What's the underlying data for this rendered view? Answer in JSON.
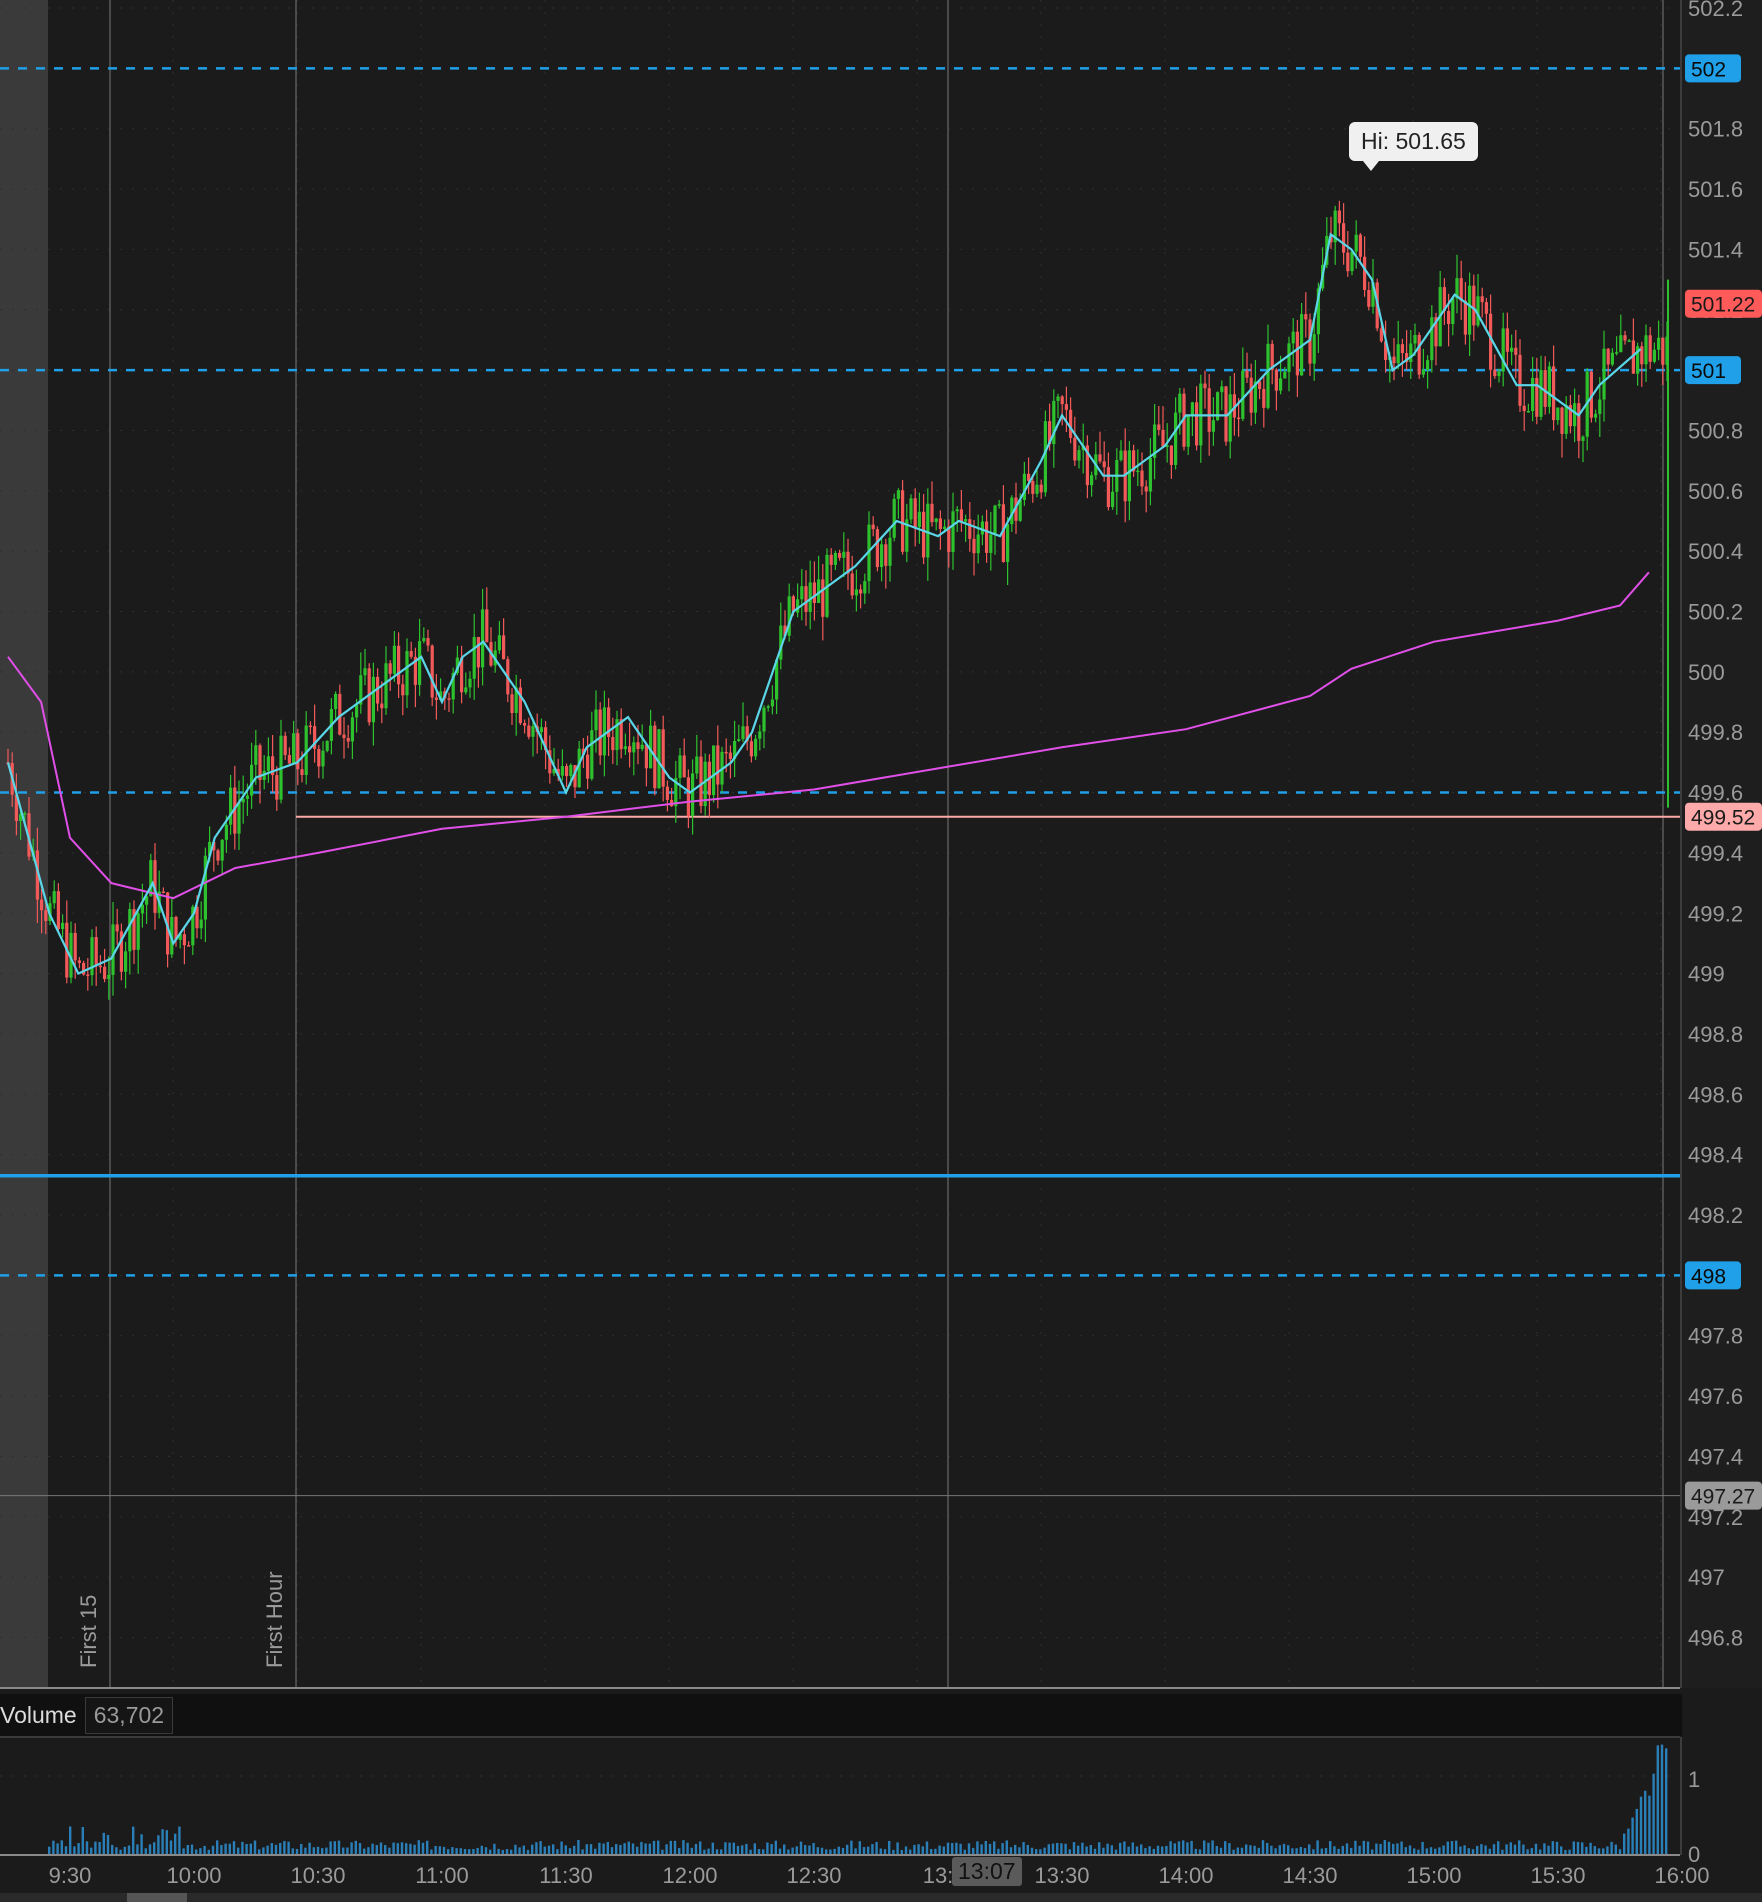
{
  "chart_data": {
    "type": "candlestick",
    "price_axis": {
      "ticks": [
        "502.2",
        "501.8",
        "501.6",
        "501.4",
        "501.2",
        "500.8",
        "500.6",
        "500.4",
        "500.2",
        "500",
        "499.8",
        "499.6",
        "499.4",
        "499.2",
        "499",
        "498.8",
        "498.6",
        "498.4",
        "498.2",
        "497.8",
        "497.6",
        "497.4",
        "497.2",
        "497",
        "496.8"
      ],
      "range": [
        496.64,
        502.24
      ]
    },
    "time_axis": {
      "ticks": [
        "9:30",
        "10:00",
        "10:30",
        "11:00",
        "11:30",
        "12:00",
        "12:30",
        "13:",
        "13:30",
        "14:00",
        "14:30",
        "15:00",
        "15:30",
        "16:00"
      ],
      "range": [
        "9:30",
        "16:00"
      ]
    },
    "price_level_tags": [
      {
        "label": "502",
        "value": 502.0,
        "color": "#1fa0e8",
        "style": "dashed"
      },
      {
        "label": "501",
        "value": 501.0,
        "color": "#1fa0e8",
        "style": "dashed"
      },
      {
        "label": "498",
        "value": 498.0,
        "color": "#1fa0e8",
        "style": "dashed"
      }
    ],
    "unlabeled_levels": [
      {
        "value": 499.6,
        "color": "#1fa0e8",
        "style": "dashed"
      },
      {
        "value": 498.33,
        "color": "#1fa0e8",
        "style": "solid"
      },
      {
        "value": 497.27,
        "color": "#777777",
        "style": "solid"
      }
    ],
    "last_price": {
      "label": "501.22",
      "value": 501.22,
      "color": "#ff5a5a"
    },
    "prev_close": {
      "label": "499.52",
      "value": 499.52,
      "color": "#ffaaaa"
    },
    "gray_level_tag": {
      "label": "497.27",
      "value": 497.27
    },
    "high_label": "Hi: 501.65",
    "high_value": 501.65,
    "session_markers": [
      {
        "label": "First 15",
        "time": "9:45"
      },
      {
        "label": "First Hour",
        "time": "10:30"
      }
    ],
    "cursor_time": "13:07",
    "ema_path": [
      [
        "9:15",
        499.7
      ],
      [
        "9:25",
        499.2
      ],
      [
        "9:32",
        499.0
      ],
      [
        "9:40",
        499.05
      ],
      [
        "9:50",
        499.3
      ],
      [
        "9:55",
        499.1
      ],
      [
        "10:00",
        499.2
      ],
      [
        "10:05",
        499.45
      ],
      [
        "10:15",
        499.65
      ],
      [
        "10:25",
        499.7
      ],
      [
        "10:35",
        499.85
      ],
      [
        "10:45",
        499.95
      ],
      [
        "10:55",
        500.05
      ],
      [
        "11:00",
        499.9
      ],
      [
        "11:05",
        500.05
      ],
      [
        "11:10",
        500.1
      ],
      [
        "11:20",
        499.9
      ],
      [
        "11:30",
        499.6
      ],
      [
        "11:35",
        499.75
      ],
      [
        "11:45",
        499.85
      ],
      [
        "11:55",
        499.65
      ],
      [
        "12:00",
        499.6
      ],
      [
        "12:10",
        499.7
      ],
      [
        "12:15",
        499.8
      ],
      [
        "12:25",
        500.2
      ],
      [
        "12:30",
        500.25
      ],
      [
        "12:40",
        500.35
      ],
      [
        "12:50",
        500.5
      ],
      [
        "13:00",
        500.45
      ],
      [
        "13:05",
        500.5
      ],
      [
        "13:15",
        500.45
      ],
      [
        "13:25",
        500.7
      ],
      [
        "13:30",
        500.85
      ],
      [
        "13:40",
        500.65
      ],
      [
        "13:45",
        500.65
      ],
      [
        "13:55",
        500.75
      ],
      [
        "14:00",
        500.85
      ],
      [
        "14:10",
        500.85
      ],
      [
        "14:20",
        501.0
      ],
      [
        "14:30",
        501.1
      ],
      [
        "14:35",
        501.45
      ],
      [
        "14:40",
        501.4
      ],
      [
        "14:45",
        501.3
      ],
      [
        "14:50",
        501.0
      ],
      [
        "14:55",
        501.05
      ],
      [
        "15:05",
        501.25
      ],
      [
        "15:10",
        501.2
      ],
      [
        "15:20",
        500.95
      ],
      [
        "15:25",
        500.95
      ],
      [
        "15:35",
        500.85
      ],
      [
        "15:40",
        500.95
      ],
      [
        "15:50",
        501.07
      ]
    ],
    "vwap_path": [
      [
        "9:15",
        500.05
      ],
      [
        "9:23",
        499.9
      ],
      [
        "9:30",
        499.45
      ],
      [
        "9:40",
        499.3
      ],
      [
        "9:55",
        499.25
      ],
      [
        "10:10",
        499.35
      ],
      [
        "10:30",
        499.4
      ],
      [
        "11:00",
        499.48
      ],
      [
        "11:30",
        499.52
      ],
      [
        "12:00",
        499.57
      ],
      [
        "12:30",
        499.61
      ],
      [
        "13:00",
        499.68
      ],
      [
        "13:30",
        499.75
      ],
      [
        "14:00",
        499.81
      ],
      [
        "14:30",
        499.92
      ],
      [
        "14:40",
        500.01
      ],
      [
        "15:00",
        500.1
      ],
      [
        "15:30",
        500.17
      ],
      [
        "15:45",
        500.22
      ],
      [
        "15:52",
        500.33
      ]
    ],
    "volume": {
      "label": "Volume",
      "value": "63,702",
      "axis_ticks": [
        "1",
        "0"
      ]
    },
    "colors": {
      "up": "#2ec12e",
      "down": "#f25a5a",
      "ema": "#5ad6e8",
      "vwap": "#e050e8",
      "level": "#1fa0e8"
    }
  }
}
